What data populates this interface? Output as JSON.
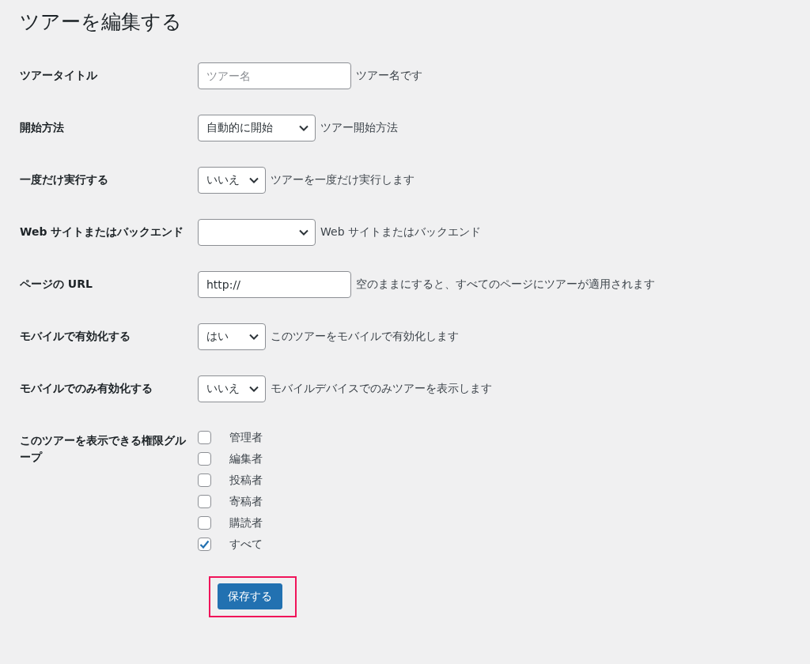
{
  "page_title": "ツアーを編集する",
  "fields": [
    {
      "kind": "text",
      "label": "ツアータイトル",
      "placeholder": "ツアー名",
      "description": "ツアー名です"
    },
    {
      "kind": "select",
      "label": "開始方法",
      "value": "自動的に開始",
      "description": "ツアー開始方法"
    },
    {
      "kind": "select",
      "label": "一度だけ実行する",
      "value": "いいえ",
      "description": "ツアーを一度だけ実行します"
    },
    {
      "kind": "select",
      "label": "Web サイトまたはバックエンド",
      "description": "Web サイトまたはバックエンド"
    },
    {
      "kind": "text",
      "label": "ページの URL",
      "value": "http://",
      "description": "空のままにすると、すべてのページにツアーが適用されます"
    },
    {
      "kind": "select",
      "label": "モバイルで有効化する",
      "value": "はい",
      "description": "このツアーをモバイルで有効化します"
    },
    {
      "kind": "select",
      "label": "モバイルでのみ有効化する",
      "value": "いいえ",
      "description": "モバイルデバイスでのみツアーを表示します"
    },
    {
      "kind": "checkboxes",
      "label": "このツアーを表示できる権限グループ",
      "options": [
        {
          "label": "管理者",
          "checked": false
        },
        {
          "label": "編集者",
          "checked": false
        },
        {
          "label": "投稿者",
          "checked": false
        },
        {
          "label": "寄稿者",
          "checked": false
        },
        {
          "label": "購読者",
          "checked": false
        },
        {
          "label": "すべて",
          "checked": true
        }
      ]
    }
  ],
  "save_button": {
    "label": "保存する",
    "highlighted": true
  }
}
